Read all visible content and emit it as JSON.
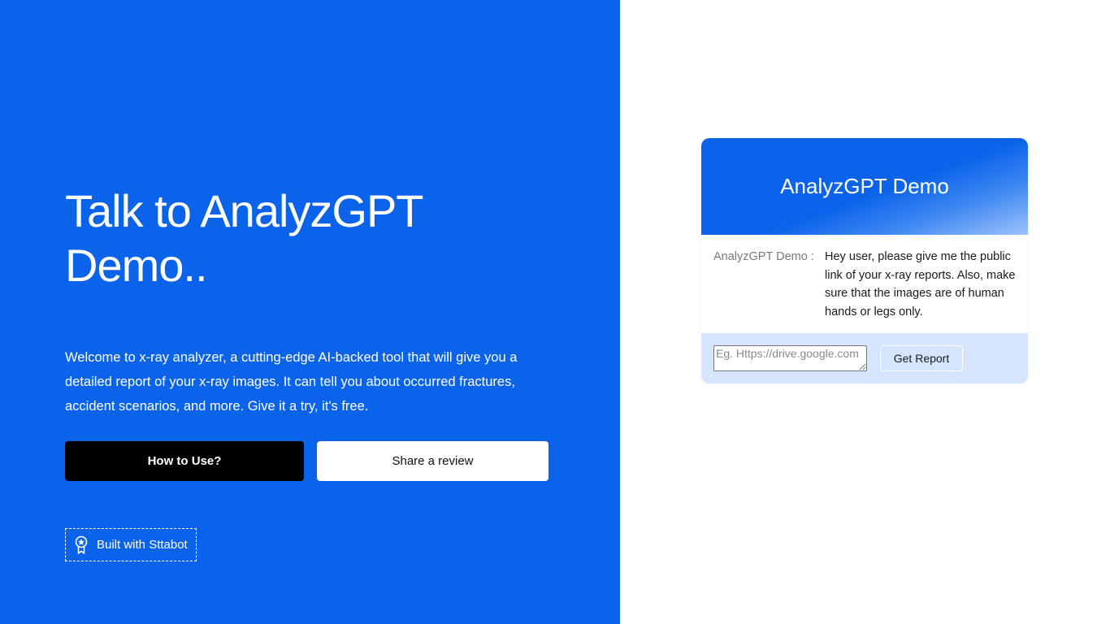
{
  "hero": {
    "title": "Talk to AnalyzGPT Demo..",
    "description": "Welcome to x-ray analyzer, a cutting-edge AI-backed tool that will give you a detailed report of your x-ray images. It can tell you about occurred fractures, accident scenarios, and more. Give it a try, it's free."
  },
  "buttons": {
    "how_to_use": "How to Use?",
    "share_review": "Share a review"
  },
  "badge": {
    "label": "Built with Sttabot",
    "icon": "award-ribbon-icon"
  },
  "chat": {
    "header_title": "AnalyzGPT Demo",
    "sender": "AnalyzGPT Demo :",
    "message": "Hey user, please give me the public link of your x-ray reports. Also, make sure that the images are of human hands or legs only.",
    "input_placeholder": "Eg. Https://drive.google.com",
    "submit_label": "Get Report"
  },
  "colors": {
    "primary_blue": "#0b63ea",
    "chat_footer_bg": "#d4e5fd",
    "dark_button": "#000000"
  }
}
